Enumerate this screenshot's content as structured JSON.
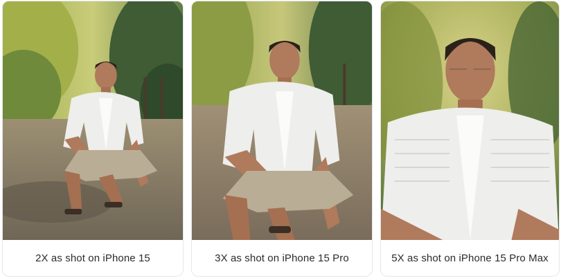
{
  "cards": [
    {
      "caption": "2X as shot on iPhone 15"
    },
    {
      "caption": "3X as shot on iPhone 15 Pro"
    },
    {
      "caption": "5X as shot on iPhone 15 Pro Max"
    }
  ],
  "colors": {
    "card_border": "#e4e6ea",
    "caption_text": "#2b2b2b",
    "foliage_bright": "#b7c25a",
    "foliage_dark": "#3d5a2c",
    "ground": "#8a7a66",
    "shirt": "#eeeeec",
    "skin": "#b07a5c",
    "shorts": "#b9ad95",
    "hair": "#2a211b"
  }
}
